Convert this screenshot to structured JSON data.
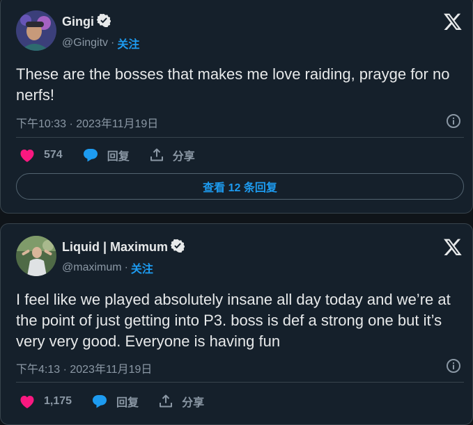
{
  "tweets": [
    {
      "display_name": "Gingi",
      "handle": "@Gingitv",
      "separator": "·",
      "follow_label": "关注",
      "text": "These are the bosses that makes me love raiding, prayge for no nerfs!",
      "timestamp": "下午10:33 · 2023年11月19日",
      "likes": "574",
      "reply_label": "回复",
      "share_label": "分享",
      "view_replies_label": "查看 12 条回复"
    },
    {
      "display_name": "Liquid | Maximum",
      "handle": "@maximum",
      "separator": "·",
      "follow_label": "关注",
      "text": "I feel like we played absolutely insane all day today and we’re at the point of just getting into P3. boss is def a strong one but it’s very very good. Everyone is having fun",
      "timestamp": "下午4:13 · 2023年11月19日",
      "likes": "1,175",
      "reply_label": "回复",
      "share_label": "分享"
    }
  ],
  "colors": {
    "background": "#0f1419",
    "card": "#15202b",
    "border": "#38444d",
    "accent": "#1d9bf0",
    "like": "#f91880",
    "muted": "#8b98a5",
    "text": "#e7e9ea"
  },
  "icons": [
    "verified-badge-icon",
    "x-logo-icon",
    "info-icon",
    "heart-icon",
    "reply-bubble-icon",
    "share-icon"
  ]
}
